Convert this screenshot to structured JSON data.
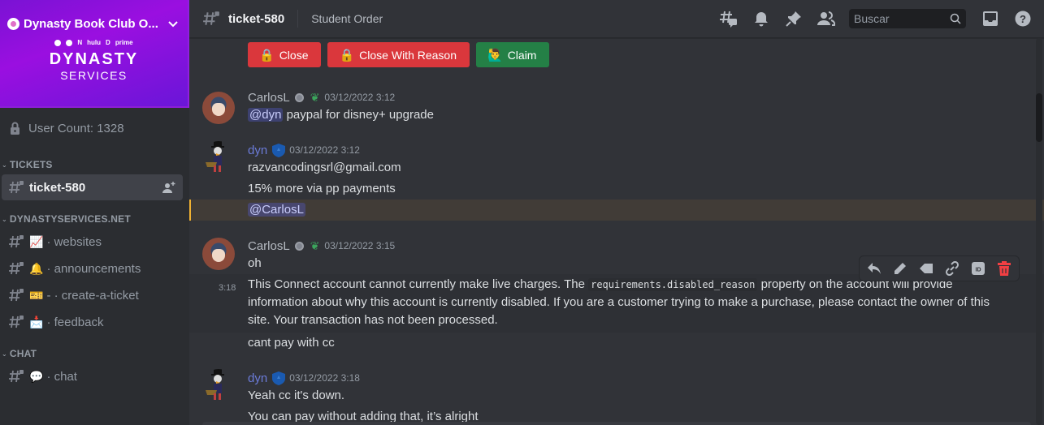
{
  "server": {
    "name": "Dynasty Book Club O...",
    "banner_brands": [
      "spotify",
      "crunchyroll",
      "N",
      "hulu",
      "D",
      "prime"
    ],
    "banner_title": "DYNASTY",
    "banner_subtitle": "SERVICES",
    "user_count": "User Count: 1328"
  },
  "sidebar": {
    "categories": [
      {
        "label": "TICKETS",
        "channels": [
          {
            "name": "ticket-580",
            "emoji": "",
            "active": true
          }
        ]
      },
      {
        "label": "DYNASTYSERVICES.NET",
        "channels": [
          {
            "name": "· websites",
            "emoji": "📈"
          },
          {
            "name": "· announcements",
            "emoji": "🔔"
          },
          {
            "name": "- · create-a-ticket",
            "emoji": "🎫"
          },
          {
            "name": "· feedback",
            "emoji": "📩"
          }
        ]
      },
      {
        "label": "CHAT",
        "channels": [
          {
            "name": "· chat",
            "emoji": "💬"
          }
        ]
      }
    ]
  },
  "header": {
    "channel": "ticket-580",
    "topic": "Student Order",
    "search_placeholder": "Buscar",
    "icons": [
      "threads-icon",
      "bell-icon",
      "pin-icon",
      "members-icon",
      "inbox-icon",
      "help-icon"
    ]
  },
  "ticket_buttons": [
    {
      "label": "Close",
      "emoji": "🔒",
      "color": "#da373c"
    },
    {
      "label": "Close With Reason",
      "emoji": "🔒",
      "color": "#da373c"
    },
    {
      "label": "Claim",
      "emoji": "🙋‍♂️",
      "color": "#248046"
    }
  ],
  "messages": [
    {
      "author": "CarlosL",
      "timestamp": "03/12/2022 3:12",
      "lines": [
        {
          "mention": "@dyn",
          "text": " paypal for disney+ upgrade"
        }
      ]
    },
    {
      "author": "dyn",
      "timestamp": "03/12/2022 3:12",
      "lines": [
        {
          "text": "razvancodingsrl@gmail.com"
        },
        {
          "text": "15% more via pp payments"
        },
        {
          "mention": "@CarlosL",
          "text": ""
        }
      ]
    },
    {
      "author": "CarlosL",
      "timestamp": "03/12/2022 3:15",
      "lines": [
        {
          "text": "oh"
        },
        {
          "hover_time": "3:18",
          "text_before": "This Connect account cannot currently make live charges. The ",
          "code": "requirements.disabled_reason",
          "text_after": " property on the account will provide information about why this account is currently disabled. If you are a customer trying to make a purchase, please contact the owner of this site. Your transaction has not been processed."
        },
        {
          "text": "cant pay with cc"
        }
      ]
    },
    {
      "author": "dyn",
      "timestamp": "03/12/2022 3:18",
      "lines": [
        {
          "text": "Yeah cc it's down."
        },
        {
          "text": "You can pay without adding that, it’s alright"
        }
      ]
    }
  ],
  "message_actions": [
    "reply-icon",
    "edit-icon",
    "tag-icon",
    "link-icon",
    "id-icon",
    "delete-icon"
  ],
  "colors": {
    "accent": "#5865f2",
    "danger": "#da373c",
    "success": "#248046",
    "mention_highlight": "#f0b232"
  }
}
